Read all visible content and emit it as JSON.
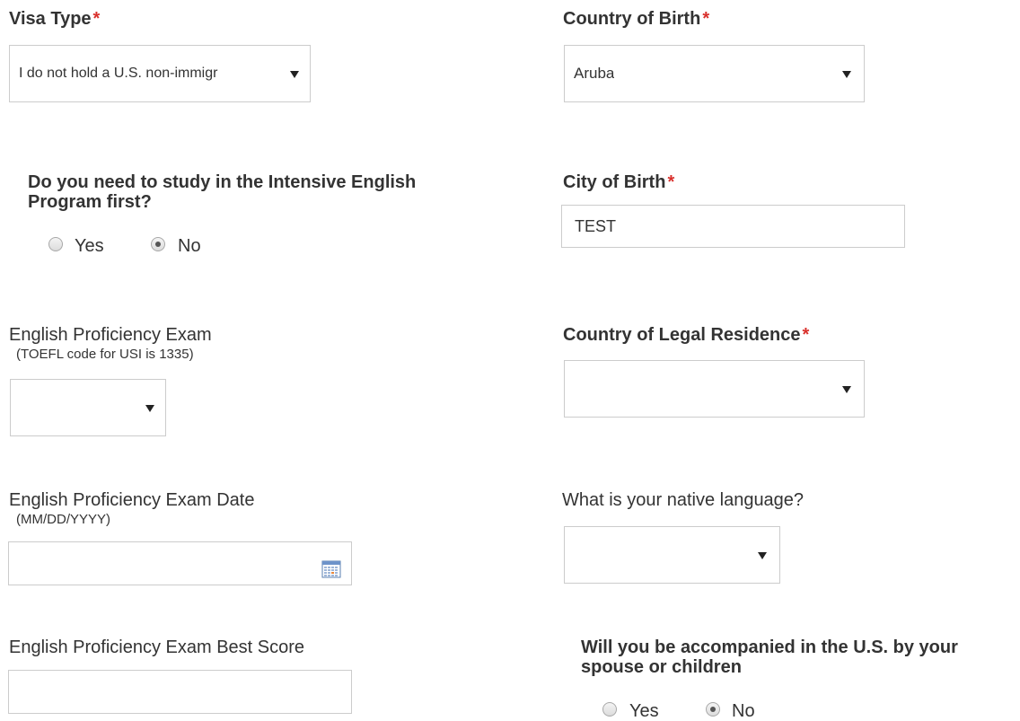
{
  "fields": {
    "visa_type": {
      "label": "Visa Type",
      "required_mark": "*",
      "value": "I do not hold a U.S. non-immigr"
    },
    "country_of_birth": {
      "label": "Country of Birth",
      "required_mark": "*",
      "value": "Aruba"
    },
    "intensive_english": {
      "question_line1": "Do you need to study in the Intensive English",
      "question_line2": "Program first?",
      "option_yes": "Yes",
      "option_no": "No",
      "selected": "No"
    },
    "city_of_birth": {
      "label": "City of Birth",
      "required_mark": "*",
      "value": "TEST"
    },
    "english_exam": {
      "label": "English Proficiency Exam",
      "hint": "(TOEFL code for USI is 1335)",
      "value": ""
    },
    "country_of_residence": {
      "label": "Country of Legal Residence",
      "required_mark": "*",
      "value": ""
    },
    "exam_date": {
      "label": "English Proficiency Exam Date",
      "hint": "(MM/DD/YYYY)",
      "value": ""
    },
    "native_language": {
      "label": "What is your native language?",
      "value": ""
    },
    "exam_score": {
      "label": "English Proficiency Exam Best Score",
      "value": ""
    },
    "accompanied": {
      "question_line1": "Will you be accompanied in the U.S. by your",
      "question_line2": "spouse or children",
      "option_yes": "Yes",
      "option_no": "No",
      "selected": "No"
    }
  },
  "icons": {
    "calendar": "calendar-icon",
    "dropdown": "chevron-down-icon"
  },
  "colors": {
    "required": "#d9302c",
    "text": "#333333",
    "border": "#cccccc"
  }
}
